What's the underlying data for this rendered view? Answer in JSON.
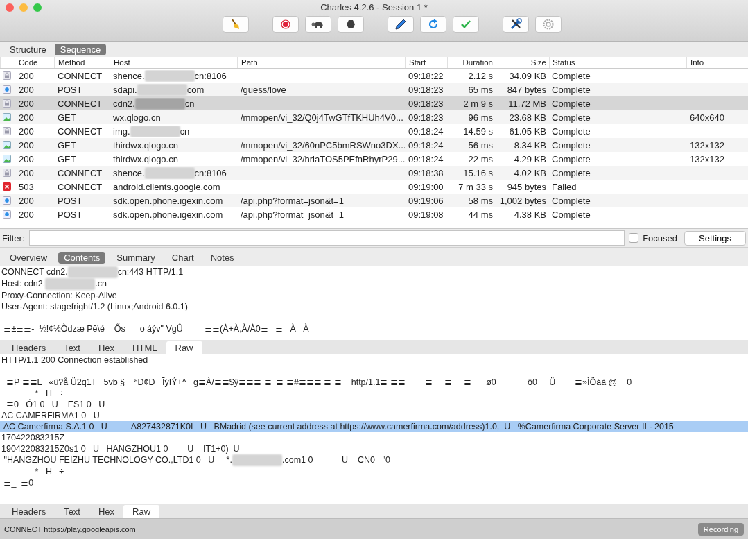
{
  "window": {
    "title": "Charles 4.2.6 - Session 1 *"
  },
  "view_tabs": [
    {
      "label": "Structure",
      "selected": false
    },
    {
      "label": "Sequence",
      "selected": true
    }
  ],
  "table": {
    "columns": [
      "Code",
      "Method",
      "Host",
      "Path",
      "Start",
      "Duration",
      "Size",
      "Status",
      "Info"
    ],
    "rows": [
      {
        "kind": "lock",
        "code": "200",
        "method": "CONNECT",
        "host": [
          "shence.",
          "cn:8106"
        ],
        "start": "09:18:22",
        "duration": "2.12 s",
        "size": "34.09 KB",
        "status": "Complete",
        "selected": false
      },
      {
        "kind": "request",
        "code": "200",
        "method": "POST",
        "host": [
          "sdapi.",
          "com"
        ],
        "path": "/guess/love",
        "start": "09:18:23",
        "duration": "65 ms",
        "size": "847 bytes",
        "status": "Complete",
        "selected": false
      },
      {
        "kind": "lock",
        "code": "200",
        "method": "CONNECT",
        "host": [
          "cdn2.",
          "cn"
        ],
        "start": "09:18:23",
        "duration": "2 m 9 s",
        "size": "11.72 MB",
        "status": "Complete",
        "selected": true
      },
      {
        "kind": "image",
        "code": "200",
        "method": "GET",
        "host": [
          "wx.qlogo.cn"
        ],
        "path": "/mmopen/vi_32/Q0j4TwGTfTKHUh4V0...",
        "start": "09:18:23",
        "duration": "96 ms",
        "size": "23.68 KB",
        "status": "Complete",
        "info": "640x640",
        "selected": false
      },
      {
        "kind": "lock",
        "code": "200",
        "method": "CONNECT",
        "host": [
          "img.",
          "cn"
        ],
        "start": "09:18:24",
        "duration": "14.59 s",
        "size": "61.05 KB",
        "status": "Complete",
        "selected": false
      },
      {
        "kind": "image",
        "code": "200",
        "method": "GET",
        "host": [
          "thirdwx.qlogo.cn"
        ],
        "path": "/mmopen/vi_32/60nPC5bmRSWno3DX...",
        "start": "09:18:24",
        "duration": "56 ms",
        "size": "8.34 KB",
        "status": "Complete",
        "info": "132x132",
        "selected": false
      },
      {
        "kind": "image",
        "code": "200",
        "method": "GET",
        "host": [
          "thirdwx.qlogo.cn"
        ],
        "path": "/mmopen/vi_32/hriaTOS5PEfnRhyrP29...",
        "start": "09:18:24",
        "duration": "22 ms",
        "size": "4.29 KB",
        "status": "Complete",
        "info": "132x132",
        "selected": false
      },
      {
        "kind": "lock",
        "code": "200",
        "method": "CONNECT",
        "host": [
          "shence.",
          "cn:8106"
        ],
        "start": "09:18:38",
        "duration": "15.16 s",
        "size": "4.02 KB",
        "status": "Complete",
        "selected": false
      },
      {
        "kind": "error",
        "code": "503",
        "method": "CONNECT",
        "host": [
          "android.clients.google.com"
        ],
        "start": "09:19:00",
        "duration": "7 m 33 s",
        "size": "945 bytes",
        "status": "Failed",
        "selected": false
      },
      {
        "kind": "request",
        "code": "200",
        "method": "POST",
        "host": [
          "sdk.open.phone.igexin.com"
        ],
        "path": "/api.php?format=json&t=1",
        "start": "09:19:06",
        "duration": "58 ms",
        "size": "1,002 bytes",
        "status": "Complete",
        "selected": false
      },
      {
        "kind": "request",
        "code": "200",
        "method": "POST",
        "host": [
          "sdk.open.phone.igexin.com"
        ],
        "path": "/api.php?format=json&t=1",
        "start": "09:19:08",
        "duration": "44 ms",
        "size": "4.38 KB",
        "status": "Complete",
        "selected": false
      }
    ]
  },
  "filter": {
    "label": "Filter:",
    "focused": {
      "label": "Focused",
      "checked": false
    },
    "settings_button": "Settings"
  },
  "detail_tabs": [
    {
      "label": "Overview",
      "selected": false
    },
    {
      "label": "Contents",
      "selected": true
    },
    {
      "label": "Summary",
      "selected": false
    },
    {
      "label": "Chart",
      "selected": false
    },
    {
      "label": "Notes",
      "selected": false
    }
  ],
  "request": {
    "lines": [
      {
        "parts": [
          "CONNECT cdn2.",
          "cn:443 HTTP/1.1"
        ],
        "selected": false,
        "blank_before": false
      },
      {
        "parts": [
          "Host: cdn2.",
          ".cn"
        ],
        "selected": false,
        "blank_before": false
      },
      {
        "parts": [
          "Proxy-Connection: Keep-Alive"
        ],
        "selected": false,
        "blank_before": false
      },
      {
        "parts": [
          "User-Agent: stagefright/1.2 (Linux;Android 6.0.1)"
        ],
        "selected": false,
        "blank_before": false
      },
      {
        "parts": [
          " ≣±≣≣-  ½!¢½Òdzæ Pê\\é    Ős      o áýv\" VgÛ         ≣≣(À+À,À/À0≣   ≣   À   À"
        ],
        "selected": false,
        "blank_before": true
      }
    ],
    "tabs": [
      {
        "label": "Headers",
        "selected": false
      },
      {
        "label": "Text",
        "selected": false
      },
      {
        "label": "Hex",
        "selected": false
      },
      {
        "label": "HTML",
        "selected": false
      },
      {
        "label": "Raw",
        "selected": true
      }
    ]
  },
  "response": {
    "lines": [
      {
        "parts": [
          "HTTP/1.1 200 Connection established"
        ],
        "selected": false,
        "blank_before": false
      },
      {
        "parts": [
          "  ≣P ≣≣L   «ü?å Ü2q1T   5vb §    ªD¢D   ĪýIÝ+^   g≣À/≣≣$ÿ≣≣≣ ≣  ≣ ≣#≣≣≣ ≣ ≣    http/1.1≣ ≣≣        ≣     ≣     ≣      ø0             ô0     Ü        ≣»ÌÖáà @    0"
        ],
        "selected": false,
        "blank_before": true
      },
      {
        "parts": [
          "              *   H   ÷"
        ],
        "selected": false,
        "blank_before": false
      },
      {
        "parts": [
          "  ≣0   Ó1 0   U    ES1 0   U"
        ],
        "selected": false,
        "blank_before": false
      },
      {
        "parts": [
          "AC CAMERFIRMA1 0   U"
        ],
        "selected": false,
        "blank_before": false
      },
      {
        "parts": [
          " AC Camerfirma S.A.1 0   U          A827432871K0I   U   BMadrid (see current address at https://www.camerfirma.com/address)1.0,  U   %Camerfirma Corporate Server II - 2015"
        ],
        "selected": true,
        "blank_before": false
      },
      {
        "parts": [
          "170422083215Z"
        ],
        "selected": false,
        "blank_before": false
      },
      {
        "parts": [
          "190422083215Z0s1 0   U   HANGZHOU1 0        U    IT1+0)  U"
        ],
        "selected": false,
        "blank_before": false
      },
      {
        "parts": [
          " \"HANGZHOU FEIZHU TECHNOLOGY CO.,LTD1 0   U     *.",
          ".com1 0            U    CN0   \"0"
        ],
        "selected": false,
        "blank_before": false
      },
      {
        "parts": [
          "              *   H   ÷"
        ],
        "selected": false,
        "blank_before": false
      },
      {
        "parts": [
          " ≣_  ≣0"
        ],
        "selected": false,
        "blank_before": false
      }
    ],
    "tabs": [
      {
        "label": "Headers",
        "selected": false
      },
      {
        "label": "Text",
        "selected": false
      },
      {
        "label": "Hex",
        "selected": false
      },
      {
        "label": "Raw",
        "selected": true
      }
    ]
  },
  "status_bar": {
    "text": "CONNECT https://play.googleapis.com",
    "badge": "Recording"
  }
}
